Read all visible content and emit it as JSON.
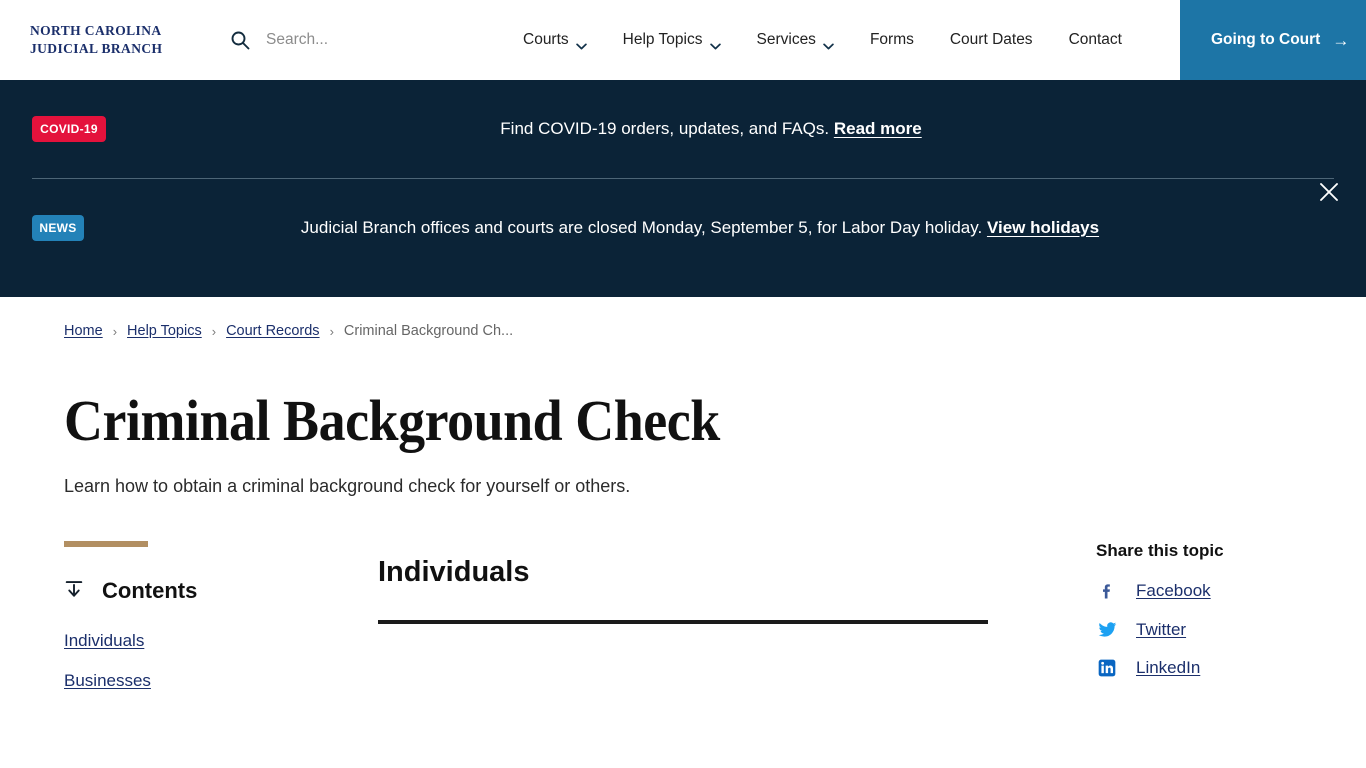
{
  "colors": {
    "brand_navy": "#1b2f6b",
    "banner_bg": "#0b2337",
    "cta_blue": "#1d75a6",
    "covid_red": "#e4123c",
    "news_blue": "#2382b8",
    "accent_tan": "#b28f62",
    "facebook_blue": "#3b5998",
    "twitter_blue": "#1da1f2",
    "linkedin_blue": "#0a66c2"
  },
  "header": {
    "logo_line1": "NORTH CAROLINA",
    "logo_line2": "JUDICIAL BRANCH",
    "search_placeholder": "Search...",
    "search_value": "",
    "search_icon": "search-icon",
    "menu": [
      {
        "label": "Courts",
        "has_caret": true
      },
      {
        "label": "Help Topics",
        "has_caret": true
      },
      {
        "label": "Services",
        "has_caret": true
      },
      {
        "label": "Forms",
        "has_caret": false
      },
      {
        "label": "Court Dates",
        "has_caret": false
      },
      {
        "label": "Contact",
        "has_caret": false
      }
    ],
    "cta_label": "Going to Court",
    "cta_arrow": "→"
  },
  "alerts": {
    "close_icon": "close-icon",
    "items": [
      {
        "badge": "COVID-19",
        "text": "Find COVID-19 orders, updates, and FAQs.",
        "link": "Read more"
      },
      {
        "badge": "NEWS",
        "text": "Judicial Branch offices and courts are closed Monday, September 5, for Labor Day holiday.",
        "link": "View holidays"
      }
    ]
  },
  "breadcrumb": {
    "items": [
      {
        "label": "Home",
        "link": true
      },
      {
        "label": "Help Topics",
        "link": true
      },
      {
        "label": "Court Records",
        "link": true
      },
      {
        "label": "Criminal Background Ch...",
        "link": false
      }
    ],
    "separator": "›"
  },
  "page": {
    "title": "Criminal Background Check",
    "subtitle": "Learn how to obtain a criminal background check for yourself or others."
  },
  "contents": {
    "heading": "Contents",
    "icon": "jump-to-contents-icon",
    "items": [
      {
        "label": "Individuals"
      },
      {
        "label": "Businesses"
      }
    ]
  },
  "main": {
    "section_title": "Individuals"
  },
  "share": {
    "heading": "Share this topic",
    "items": [
      {
        "label": "Facebook",
        "icon": "facebook-icon"
      },
      {
        "label": "Twitter",
        "icon": "twitter-icon"
      },
      {
        "label": "LinkedIn",
        "icon": "linkedin-icon"
      }
    ]
  }
}
